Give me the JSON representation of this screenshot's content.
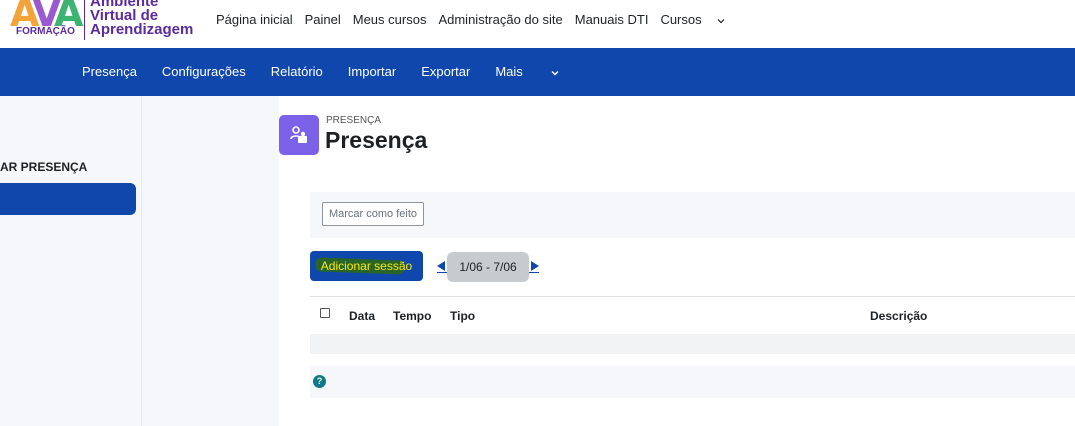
{
  "logo": {
    "letters": [
      "A",
      "V",
      "A"
    ],
    "formacao": "FORMAÇÃO",
    "text_lines": [
      "Ambiente",
      "Virtual de",
      "Aprendizagem"
    ]
  },
  "topnav": [
    "Página inicial",
    "Painel",
    "Meus cursos",
    "Administração do site",
    "Manuais DTI",
    "Cursos"
  ],
  "secondary_nav": [
    "Presença",
    "Configurações",
    "Relatório",
    "Importar",
    "Exportar",
    "Mais"
  ],
  "drawer": {
    "heading": "AR PRESENÇA"
  },
  "page": {
    "sublabel": "PRESENÇA",
    "title": "Presença"
  },
  "done_button": "Marcar como feito",
  "add_session_button": "Adicionar sessão",
  "date_range": "1/06 - 7/06",
  "table": {
    "columns": [
      "Data",
      "Tempo",
      "Tipo",
      "Descrição"
    ]
  },
  "help_icon_glyph": "?",
  "colors": {
    "brand_blue": "#0f47ad",
    "activity_icon": "#7b61e8",
    "logo_purple": "#5a2ca0"
  }
}
